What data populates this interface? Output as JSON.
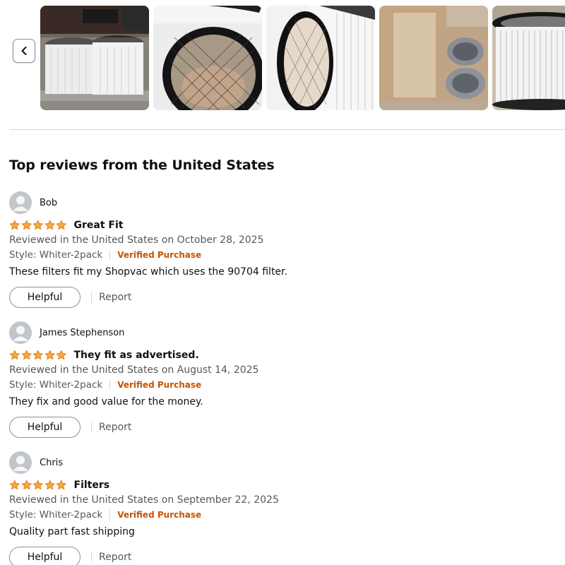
{
  "carousel": {
    "prev_icon": "chevron-left-icon",
    "thumbnails": [
      "product-photo-two-filters-in-bag",
      "product-photo-filter-top-view",
      "product-photo-filter-angled",
      "product-photo-filters-in-box",
      "product-photo-filter-pleats"
    ]
  },
  "section_title": "Top reviews from the United States",
  "colors": {
    "star": "#f3a847",
    "star_edge": "#e77600",
    "verified": "#c45500",
    "muted": "#565959"
  },
  "reviews": [
    {
      "reviewer": "Bob",
      "rating": 5,
      "title": "Great Fit",
      "meta": "Reviewed in the United States on October 28, 2025",
      "style": "Style: Whiter-2pack",
      "verified": "Verified Purchase",
      "body": "These filters fit my Shopvac which uses the 90704 filter.",
      "helpful": "Helpful",
      "report": "Report"
    },
    {
      "reviewer": "James Stephenson",
      "rating": 5,
      "title": "They fit as advertised.",
      "meta": "Reviewed in the United States on August 14, 2025",
      "style": "Style: Whiter-2pack",
      "verified": "Verified Purchase",
      "body": "They fix and good value for the money.",
      "helpful": "Helpful",
      "report": "Report"
    },
    {
      "reviewer": "Chris",
      "rating": 5,
      "title": "Filters",
      "meta": "Reviewed in the United States on September 22, 2025",
      "style": "Style: Whiter-2pack",
      "verified": "Verified Purchase",
      "body": "Quality part fast shipping",
      "helpful": "Helpful",
      "report": "Report"
    }
  ]
}
